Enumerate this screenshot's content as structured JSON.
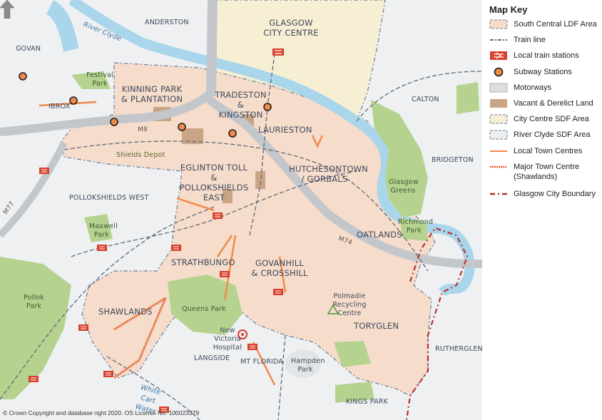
{
  "map": {
    "labels": {
      "anderston": "ANDERSTON",
      "govan": "GOVAN",
      "river_clyde": "River Clyde",
      "festival_park": "Festival Park",
      "ibrox": "IBROX",
      "kinning_park": "KINNING PARK & PLANTATION",
      "glasgow_city_centre": "GLASGOW CITY CENTRE",
      "tradeston": "TRADESTON & KINGSTON",
      "laurieston": "LAURIESTON",
      "calton": "CALTON",
      "bridgeton": "BRIDGETON",
      "m8": "M8",
      "shields_depot": "Shields Depot",
      "eglinton_toll": "EGLINTON TOLL & POLLOKSHIELDS EAST",
      "hutchesontown": "HUTCHESONTOWN / GORBALS",
      "glasgow_greens": "Glasgow Greens",
      "pollokshields_west": "POLLOKSHIELDS WEST",
      "m77": "M77",
      "maxwell_park": "Maxwell Park",
      "richmond_park": "Richmond Park",
      "oatlands": "OATLANDS",
      "m74": "M74",
      "strathbungo": "STRATHBUNGO",
      "govanhill": "GOVANHILL & CROSSHILL",
      "pollok_park": "Pollok Park",
      "polmadie": "Polmadie Recycling Centre",
      "queens_park": "Queens Park",
      "shawlands": "SHAWLANDS",
      "new_victoria": "New Victoria Hospital",
      "toryglen": "TORYGLEN",
      "langside": "LANGSIDE",
      "mt_florida": "MT FLORIDA",
      "hampden_park": "Hampden Park",
      "rutherglen": "RUTHERGLEN",
      "white_cart": "White Cart Water",
      "kings_park": "KINGS PARK"
    },
    "copyright": "© Crown Copyright and database right 2020. OS License No. 100023379"
  },
  "key": {
    "title": "Map Key",
    "items": [
      {
        "label": "South Central LDF Area",
        "icon": "ldf-area-swatch"
      },
      {
        "label": "Train line",
        "icon": "train-line-icon"
      },
      {
        "label": "Local train stations",
        "icon": "train-station-icon"
      },
      {
        "label": "Subway Stations",
        "icon": "subway-station-icon"
      },
      {
        "label": "Motorways",
        "icon": "motorway-swatch"
      },
      {
        "label": "Vacant & Derelict Land",
        "icon": "vacant-land-swatch"
      },
      {
        "label": "City Centre SDF Area",
        "icon": "city-centre-sdf-swatch"
      },
      {
        "label": "River Clyde SDF Area",
        "icon": "river-clyde-sdf-swatch"
      },
      {
        "label": "Local Town Centres",
        "icon": "local-town-centre-line"
      },
      {
        "label": "Major Town Centre (Shawlands)",
        "icon": "major-town-centre-line"
      },
      {
        "label": "Glasgow City Boundary",
        "icon": "city-boundary-line"
      }
    ]
  },
  "colors": {
    "ldf_area": "#f6dccb",
    "city_centre": "#f7efd4",
    "river": "#a9d6ea",
    "park": "#b5d38f",
    "motorway": "#cdd0d4",
    "vacant": "#c9a585",
    "town_centre": "#f08a4b",
    "boundary": "#b83232",
    "train_red": "#d9402b"
  }
}
